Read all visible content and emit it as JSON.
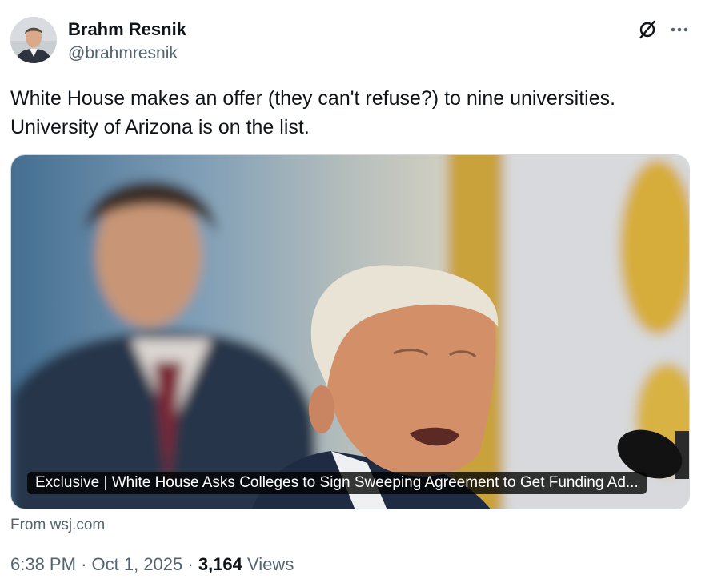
{
  "author": {
    "name": "Brahm Resnik",
    "handle": "@brahmresnik"
  },
  "icons": {
    "grok": "grok-slash-circle-icon",
    "more": "more-horizontal-dots-icon"
  },
  "tweet": {
    "text_lines": [
      "White House makes an offer (they can't refuse?) to nine universities.",
      "University of Arizona is on the list."
    ]
  },
  "card": {
    "title": "Exclusive | White House Asks Colleges to Sign Sweeping Agreement to Get Funding Ad..."
  },
  "source": "From wsj.com",
  "meta": {
    "time": "6:38 PM",
    "separator": "·",
    "date": "Oct 1, 2025",
    "views_count": "3,164",
    "views_label": "Views"
  },
  "colors": {
    "text_primary": "#0f1419",
    "text_secondary": "#536471",
    "border": "#cfd9de"
  }
}
